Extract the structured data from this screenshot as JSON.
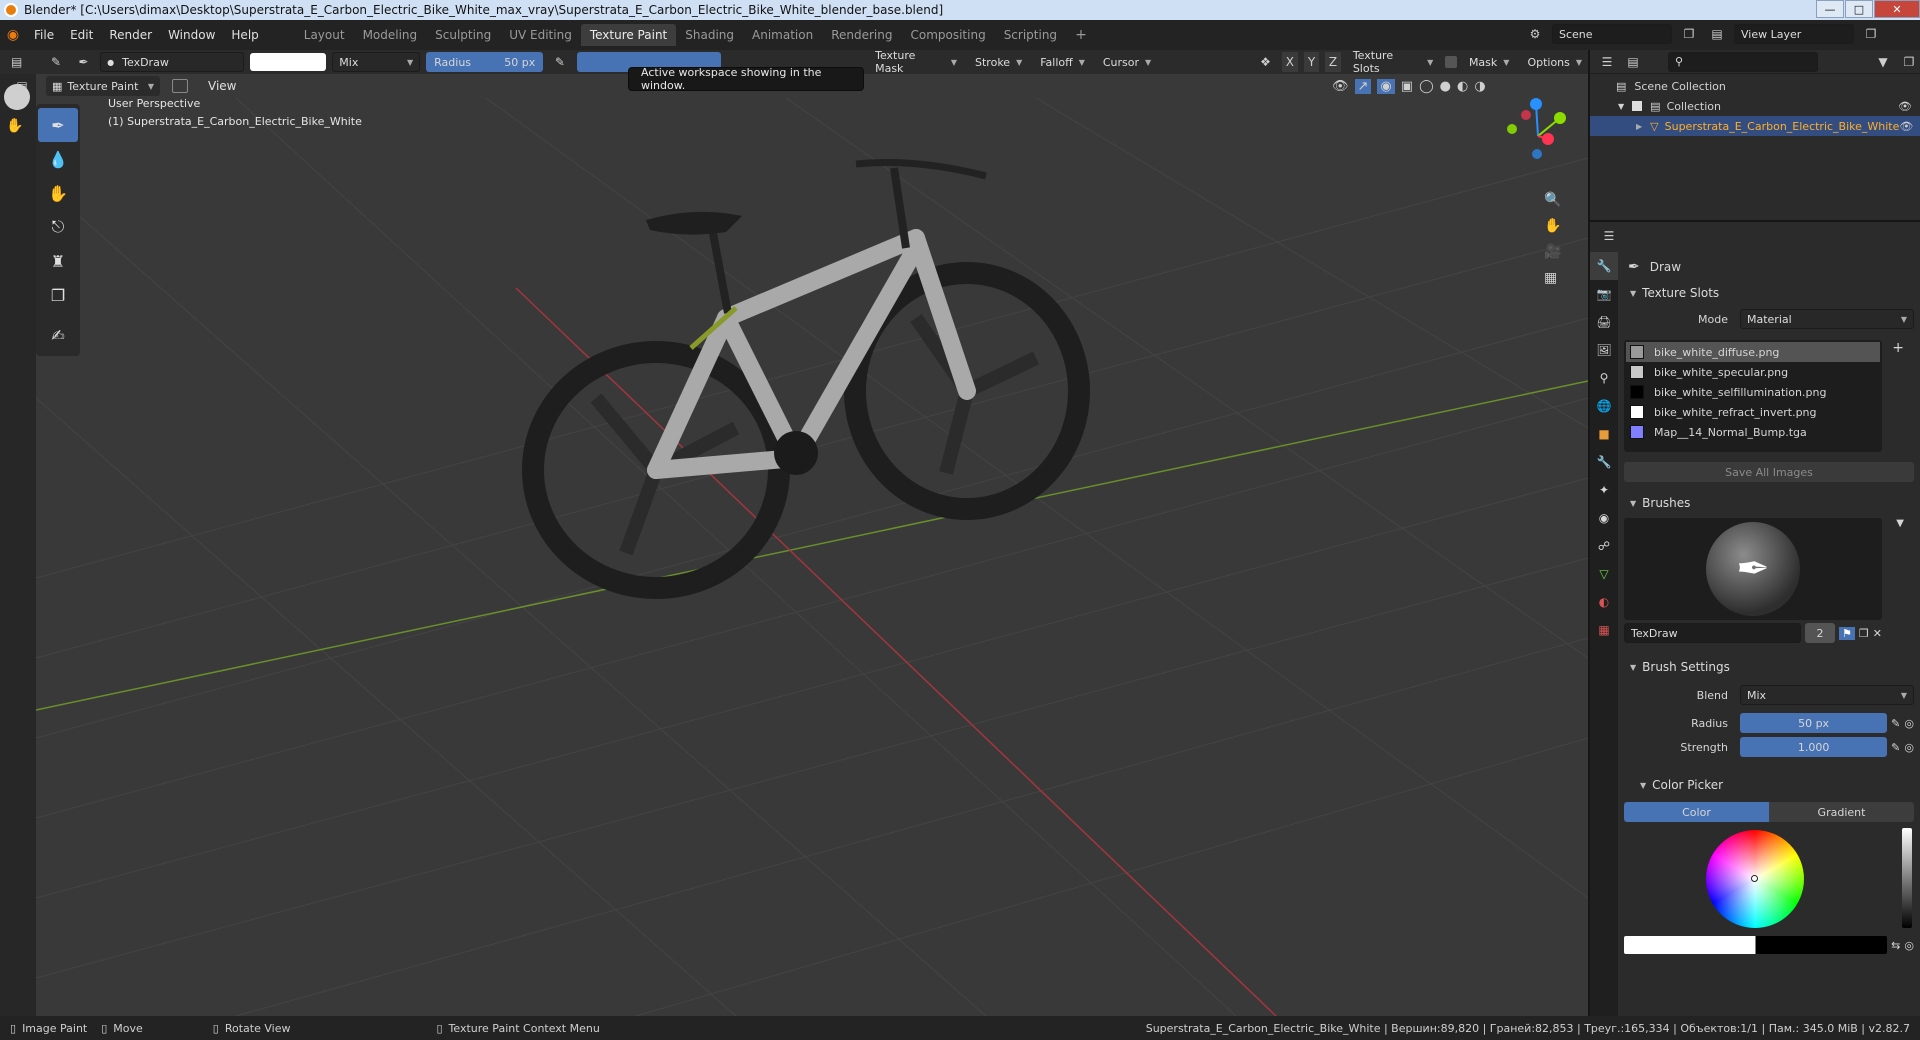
{
  "window": {
    "title": "Blender* [C:\\Users\\dimax\\Desktop\\Superstrata_E_Carbon_Electric_Bike_White_max_vray\\Superstrata_E_Carbon_Electric_Bike_White_blender_base.blend]"
  },
  "menu": {
    "file": "File",
    "edit": "Edit",
    "render": "Render",
    "window": "Window",
    "help": "Help"
  },
  "workspaces": [
    "Layout",
    "Modeling",
    "Sculpting",
    "UV Editing",
    "Texture Paint",
    "Shading",
    "Animation",
    "Rendering",
    "Compositing",
    "Scripting"
  ],
  "active_workspace": "Texture Paint",
  "scene": {
    "label": "Scene",
    "view_layer": "View Layer"
  },
  "tool_header": {
    "brush_name": "TexDraw",
    "blend": "Mix",
    "radius_label": "Radius",
    "radius_value": "50 px",
    "texture_mask": "Texture Mask",
    "stroke": "Stroke",
    "falloff": "Falloff",
    "cursor": "Cursor",
    "axis_x": "X",
    "axis_y": "Y",
    "axis_z": "Z",
    "texture_slots": "Texture Slots",
    "mask": "Mask",
    "options": "Options"
  },
  "tooltip": "Active workspace showing in the window.",
  "mode_header": {
    "mode": "Texture Paint",
    "view": "View"
  },
  "viewport": {
    "perspective": "User Perspective",
    "object": "(1) Superstrata_E_Carbon_Electric_Bike_White"
  },
  "outliner": {
    "scene_collection": "Scene Collection",
    "collection": "Collection",
    "object": "Superstrata_E_Carbon_Electric_Bike_White"
  },
  "properties": {
    "tool_name": "Draw",
    "texture_slots_title": "Texture Slots",
    "mode_label": "Mode",
    "mode_value": "Material",
    "slots": [
      {
        "name": "bike_white_diffuse.png",
        "color": "#9a9a9a"
      },
      {
        "name": "bike_white_specular.png",
        "color": "#c8c8c8"
      },
      {
        "name": "bike_white_selfillumination.png",
        "color": "#000000"
      },
      {
        "name": "bike_white_refract_invert.png",
        "color": "#ffffff"
      },
      {
        "name": "Map__14_Normal_Bump.tga",
        "color": "#8080ff"
      }
    ],
    "save_all": "Save All Images",
    "brushes_title": "Brushes",
    "brush_name": "TexDraw",
    "brush_users": "2",
    "brush_settings_title": "Brush Settings",
    "blend_label": "Blend",
    "blend_value": "Mix",
    "radius_label": "Radius",
    "radius_value": "50 px",
    "strength_label": "Strength",
    "strength_value": "1.000",
    "color_picker_title": "Color Picker",
    "color_tab": "Color",
    "gradient_tab": "Gradient"
  },
  "statusbar": {
    "image_paint": "Image Paint",
    "move": "Move",
    "rotate": "Rotate View",
    "context_menu": "Texture Paint Context Menu",
    "stats": "Superstrata_E_Carbon_Electric_Bike_White | Вершин:89,820 | Граней:82,853 | Треуг.:165,334 | Объектов:1/1 | Пам.: 345.0 MiB | v2.82.7"
  },
  "colors": {
    "accent": "#4772b3",
    "selected_object": "#ffaf29",
    "axis_x": "#ff3352",
    "axis_y": "#8bdc00",
    "axis_z": "#2890ff"
  }
}
